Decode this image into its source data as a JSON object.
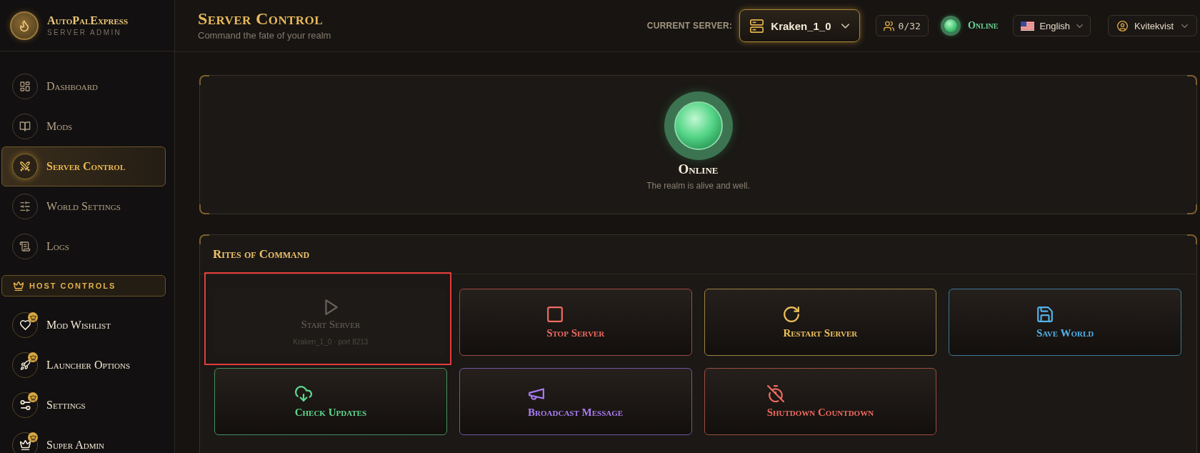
{
  "sidebar": {
    "brand": {
      "name": "AutoPalExpress",
      "subtitle": "SERVER ADMIN"
    },
    "nav_items": [
      {
        "label": "Dashboard",
        "selected": false
      },
      {
        "label": "Mods",
        "selected": false
      },
      {
        "label": "Server Control",
        "selected": true
      },
      {
        "label": "World Settings",
        "selected": false
      },
      {
        "label": "Logs",
        "selected": false
      }
    ],
    "section_label": "HOST CONTROLS",
    "host_items": [
      {
        "label": "Mod Wishlist",
        "selected": false
      },
      {
        "label": "Launcher Options",
        "selected": false
      },
      {
        "label": "Settings",
        "selected": false
      },
      {
        "label": "Super Admin",
        "selected": false
      }
    ]
  },
  "header": {
    "title": "Server Control",
    "subtitle": "Command the fate of your realm",
    "server_label": "CURRENT SERVER:",
    "server": "Kraken_1_0",
    "players": "0/32",
    "status": {
      "label": "Online",
      "online": true
    },
    "language": "English",
    "user": "Kvitekvist"
  },
  "status_card": {
    "online": true,
    "title": "Online",
    "message": "The realm is alive and well."
  },
  "actions_card": {
    "title": "Rites of Command",
    "actions": [
      {
        "label": "Start Server",
        "detail": "Kraken_1_0 · port 8213",
        "disabled": true,
        "highlighted": true
      },
      {
        "label": "Stop Server",
        "color": "#ef6b61",
        "disabled": false,
        "highlighted": false
      },
      {
        "label": "Restart Server",
        "color": "#edc15c",
        "disabled": false,
        "highlighted": false
      },
      {
        "label": "Save World",
        "color": "#52b2ea",
        "disabled": false,
        "highlighted": false
      },
      {
        "label": "Check Updates",
        "color": "#5fd98e",
        "disabled": false,
        "highlighted": false
      },
      {
        "label": "Broadcast Message",
        "color": "#a97df2",
        "disabled": false,
        "highlighted": false
      },
      {
        "label": "Shutdown Countdown",
        "color": "#ef6b61",
        "disabled": false,
        "highlighted": false
      }
    ]
  }
}
